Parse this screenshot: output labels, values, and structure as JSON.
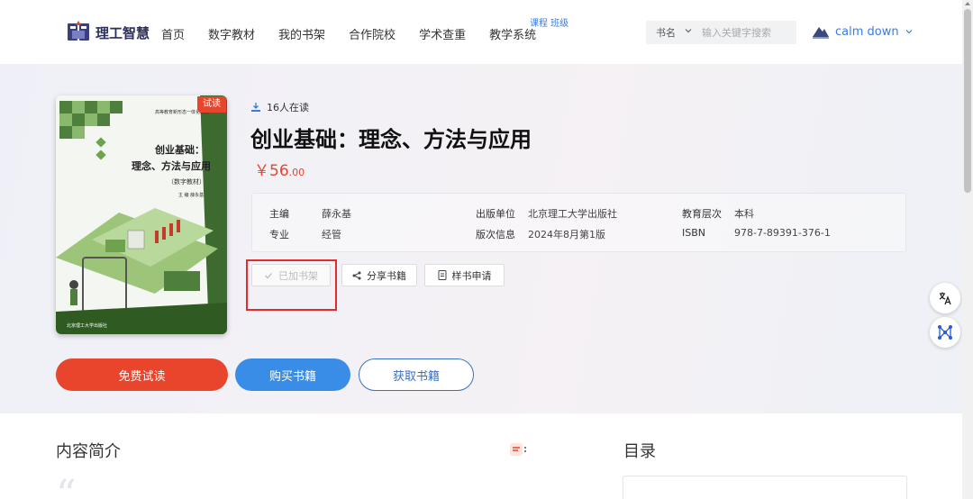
{
  "header": {
    "logo_text": "理工智慧",
    "nav": [
      "首页",
      "数字教材",
      "我的书架",
      "合作院校",
      "学术查重",
      "教学系统"
    ],
    "nav_sup": "课程 班级",
    "search": {
      "type": "书名",
      "placeholder": "输入关键字搜索"
    },
    "user_name": "calm down"
  },
  "book": {
    "readers": "16人在读",
    "title": "创业基础：理念、方法与应用",
    "price_currency": "￥",
    "price_int": "56",
    "price_dec": ".00",
    "trial_badge": "试读",
    "cover": {
      "series": "高等教育新形态一体化教材",
      "title_line1": "创业基础：",
      "title_line2": "理念、方法与应用",
      "subtitle": "（数字教材）",
      "author": "主 编    薛永基",
      "publisher": "北京理工大学出版社"
    },
    "info": [
      {
        "label": "主编",
        "value": "薛永基"
      },
      {
        "label": "出版单位",
        "value": "北京理工大学出版社"
      },
      {
        "label": "教育层次",
        "value": "本科"
      },
      {
        "label": "专业",
        "value": "经管"
      },
      {
        "label": "版次信息",
        "value": "2024年8月第1版"
      },
      {
        "label": "ISBN",
        "value": "978-7-89391-376-1"
      }
    ]
  },
  "actions": {
    "added_shelf": "已加书架",
    "share": "分享书籍",
    "sample": "样书申请",
    "free_trial": "免费试读",
    "buy": "购买书籍",
    "get": "获取书籍"
  },
  "sections": {
    "intro": "内容简介",
    "toc": "目录",
    "quote": "“"
  },
  "colors": {
    "accent_red": "#e8452c",
    "accent_blue": "#3a8de6",
    "link_blue": "#3a7be0",
    "highlight_outline": "#e42c2c"
  }
}
